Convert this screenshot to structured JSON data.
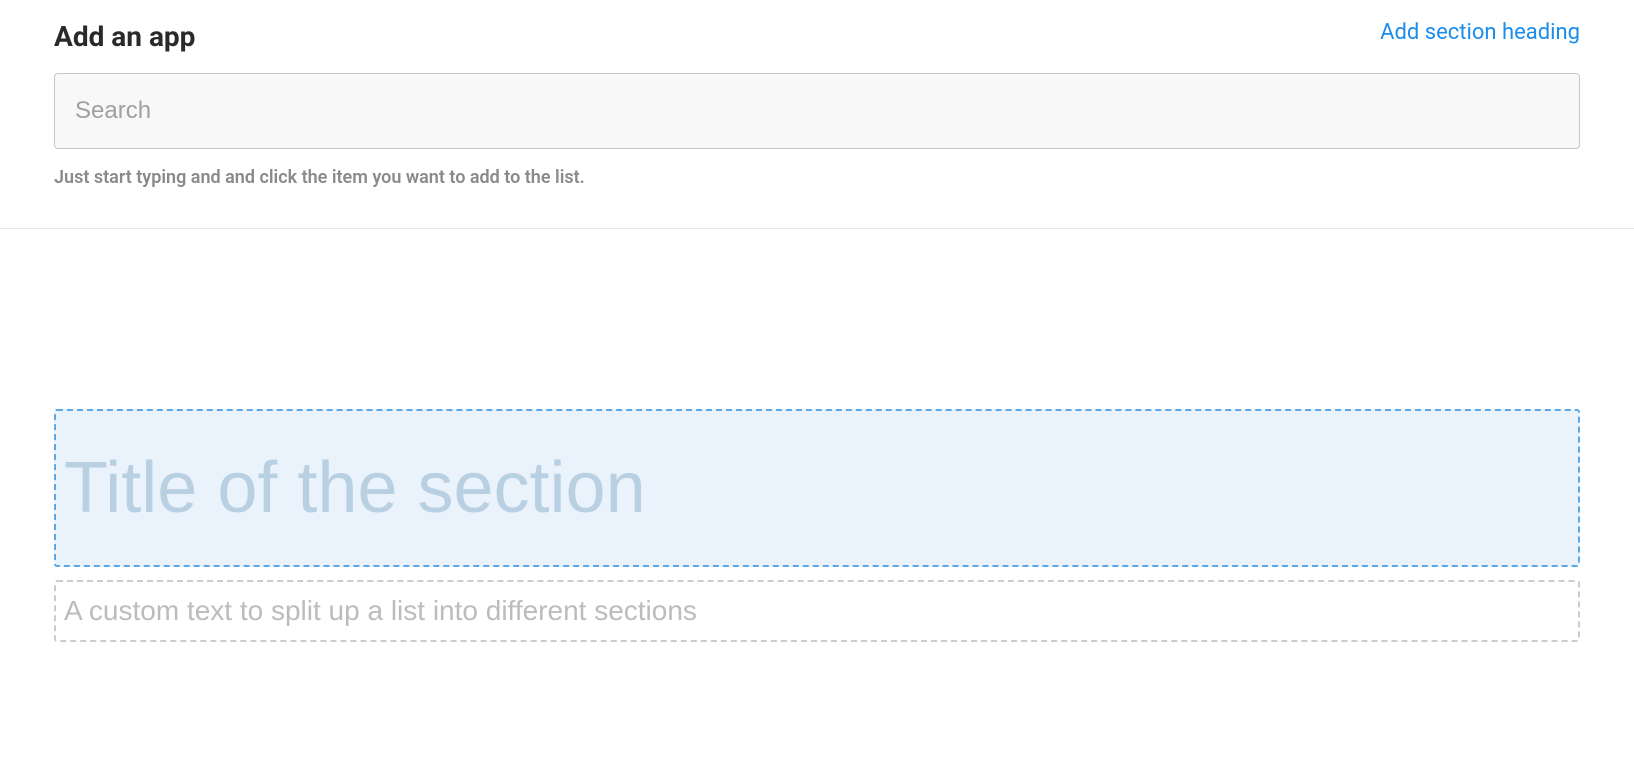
{
  "header": {
    "title": "Add an app",
    "add_section_link": "Add section heading"
  },
  "search": {
    "placeholder": "Search",
    "value": "",
    "hint": "Just start typing and and click the item you want to add to the list."
  },
  "editor": {
    "title_placeholder": "Title of the section",
    "title_value": "",
    "description_placeholder": "A custom text to split up a list into different sections",
    "description_value": ""
  }
}
